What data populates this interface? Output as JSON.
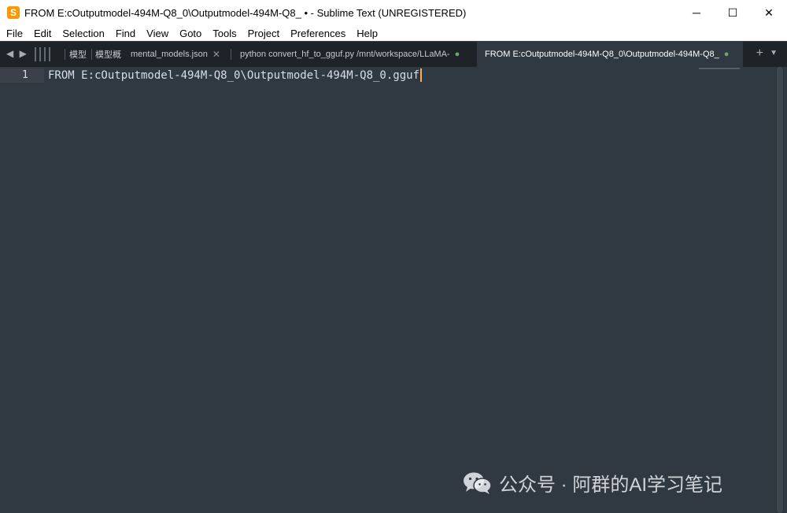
{
  "window": {
    "title": "FROM E:cOutputmodel-494M-Q8_0\\Outputmodel-494M-Q8_ • - Sublime Text (UNREGISTERED)",
    "app_icon": "sublime-text-icon",
    "controls": {
      "minimize": "─",
      "maximize": "☐",
      "close": "✕"
    }
  },
  "menu": [
    "File",
    "Edit",
    "Selection",
    "Find",
    "View",
    "Goto",
    "Tools",
    "Project",
    "Preferences",
    "Help"
  ],
  "tabbar": {
    "nav": "◀ ▶",
    "tabs": [
      {
        "label": "模型",
        "active": false
      },
      {
        "label": "模型概",
        "active": false
      },
      {
        "label": "mental_models.json",
        "active": false,
        "indicator": "✕"
      },
      {
        "label": "python convert_hf_to_gguf.py /mnt/workspace/LLaMA-",
        "active": false,
        "indicator": "●"
      },
      {
        "label": "FROM E:cOutputmodel-494M-Q8_0\\Outputmodel-494M-Q8_",
        "active": true,
        "indicator": "●"
      }
    ],
    "new_tab": "+",
    "dropdown": "▼"
  },
  "editor": {
    "lines": [
      {
        "number": "1",
        "text": "FROM E:cOutputmodel-494M-Q8_0\\Outputmodel-494M-Q8_0.gguf"
      }
    ],
    "colors": {
      "background": "#303841",
      "cursor": "#f9ae58",
      "text": "#d8dee9"
    }
  },
  "watermark": {
    "icon": "wechat-icon",
    "text": "公众号 · 阿群的AI学习笔记"
  }
}
